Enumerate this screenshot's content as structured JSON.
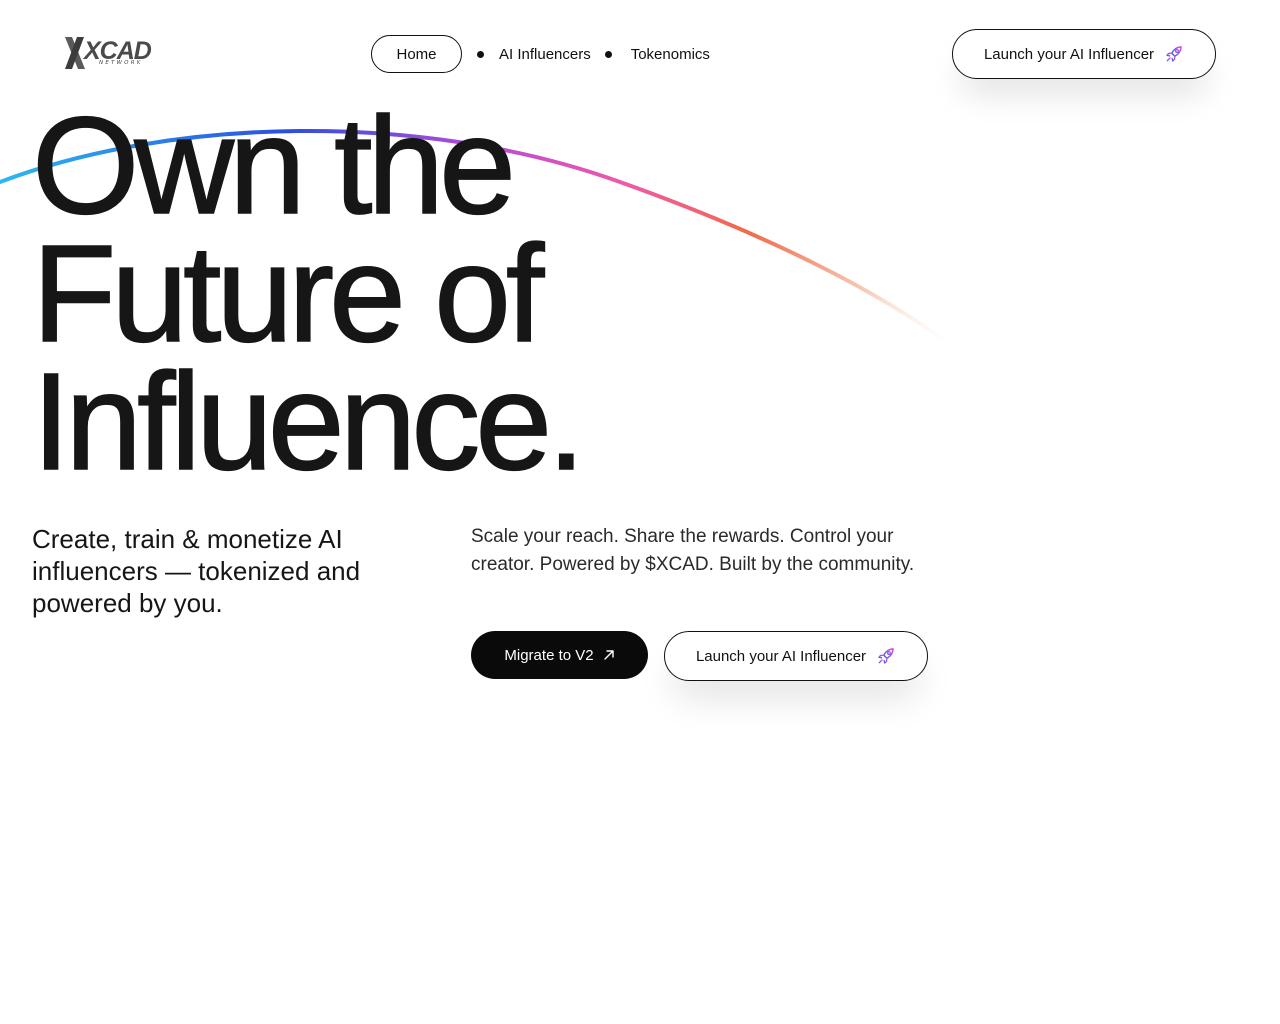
{
  "brand": {
    "logo_text": "XCAD",
    "logo_subtext": "NETWORK"
  },
  "nav": {
    "items": [
      {
        "label": "Home",
        "active": true
      },
      {
        "label": "AI Influencers",
        "active": false
      },
      {
        "label": "Tokenomics",
        "active": false
      }
    ]
  },
  "header_cta": {
    "label": "Launch your AI Influencer",
    "icon": "rocket-icon"
  },
  "hero": {
    "title_lines": [
      "Own the",
      "Future of",
      "Influence."
    ],
    "lead": "Create, train & monetize AI influencers — tokenized and powered by you.",
    "description": "Scale your reach. Share the rewards. Control your creator. Powered by $XCAD. Built by the community."
  },
  "actions": {
    "migrate_label": "Migrate to V2",
    "migrate_icon": "arrow-up-right-icon",
    "launch_label": "Launch your AI Influencer",
    "launch_icon": "rocket-icon"
  },
  "colors": {
    "text": "#161616",
    "primary_button_bg": "#0a0a0a",
    "arc_gradient": [
      "#2bb8f0",
      "#2c4fe0",
      "#b84ad8",
      "#ee5aa8",
      "#f06a4a",
      "#f7c9b6"
    ]
  }
}
